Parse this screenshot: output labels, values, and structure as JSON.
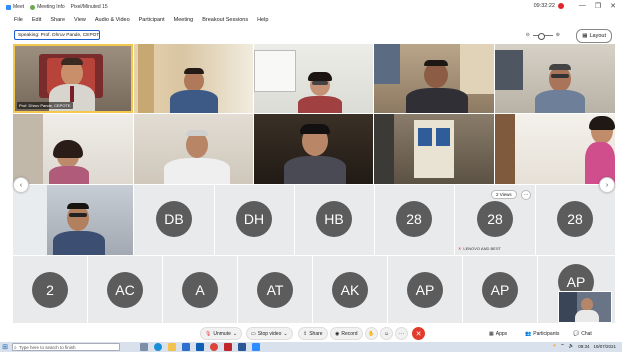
{
  "window": {
    "app_title": "Meet",
    "tabs": [
      "Meeting Info",
      "Pixel/Minuted 15"
    ],
    "clock": "09:32:22",
    "controls": [
      "—",
      "❐",
      "✕"
    ]
  },
  "menu": [
    "File",
    "Edit",
    "Share",
    "View",
    "Audio & Video",
    "Participant",
    "Meeting",
    "Breakout Sessions",
    "Help"
  ],
  "toolbar": {
    "speaker": "Speaking: Prof. Dhruv Pande, CEPOTE",
    "layout_label": "Layout"
  },
  "tiles": {
    "main_speaker_name": "Prof. Dhruv Pande, CEPOTE"
  },
  "avatars_row3": [
    "DB",
    "DH",
    "HB",
    "28",
    "28",
    "28"
  ],
  "avatars_row4": [
    "2",
    "AC",
    "A",
    "AT",
    "AK",
    "AP",
    "AP",
    "AP"
  ],
  "hover": {
    "chip": "2 Views",
    "more": "···",
    "caption": "LENOVO AND BEST"
  },
  "controls": {
    "unmute": "Unmute",
    "stop_video": "Stop video",
    "share": "Share",
    "record": "Record",
    "end": "✕",
    "apps": "Apps",
    "participants": "Participants",
    "chat": "Chat"
  },
  "taskbar": {
    "search_placeholder": "Type here to search to finish",
    "tray_time": "09:34",
    "tray_date": "19/07/2021"
  },
  "colors": {
    "active_border": "#f2c94c",
    "end_button": "#e23a2c",
    "avatar_bg": "#5c5c5c",
    "accent": "#1a5dd1"
  }
}
